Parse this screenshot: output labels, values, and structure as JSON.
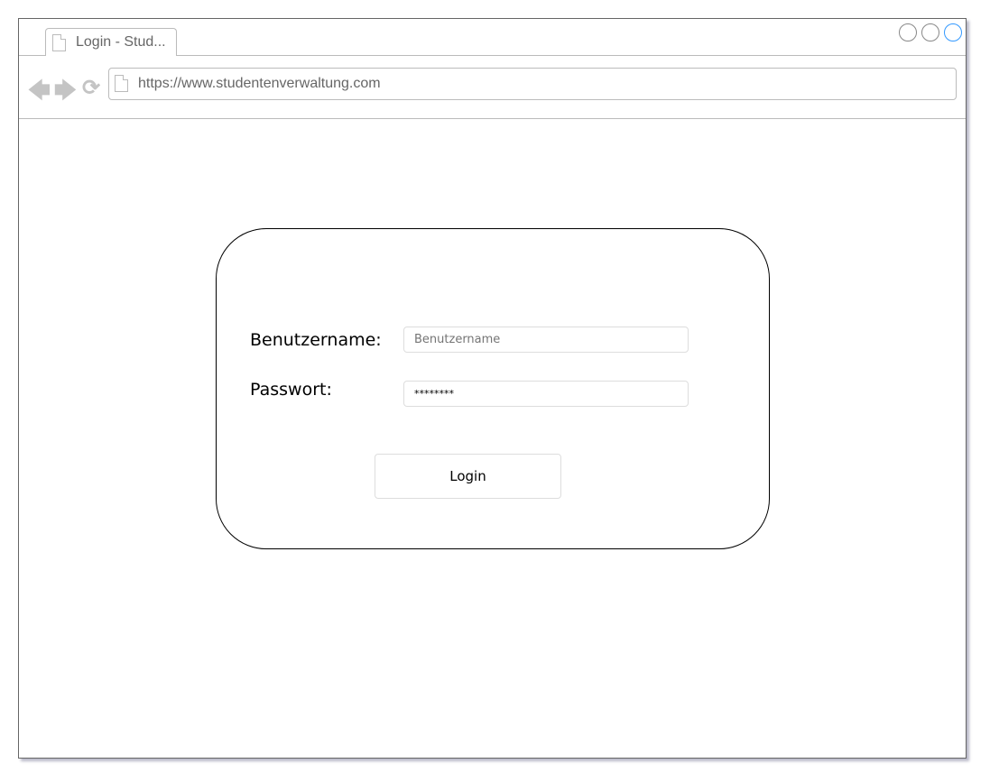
{
  "browser": {
    "tab_title": "Login - Stud...",
    "url": "https://www.studentenverwaltung.com",
    "window_controls": [
      "minimize",
      "maximize",
      "close"
    ],
    "accent_color": "#3399ff"
  },
  "login": {
    "username_label": "Benutzername:",
    "username_placeholder": "Benutzername",
    "password_label": "Passwort:",
    "password_value": "********",
    "login_button": "Login"
  }
}
